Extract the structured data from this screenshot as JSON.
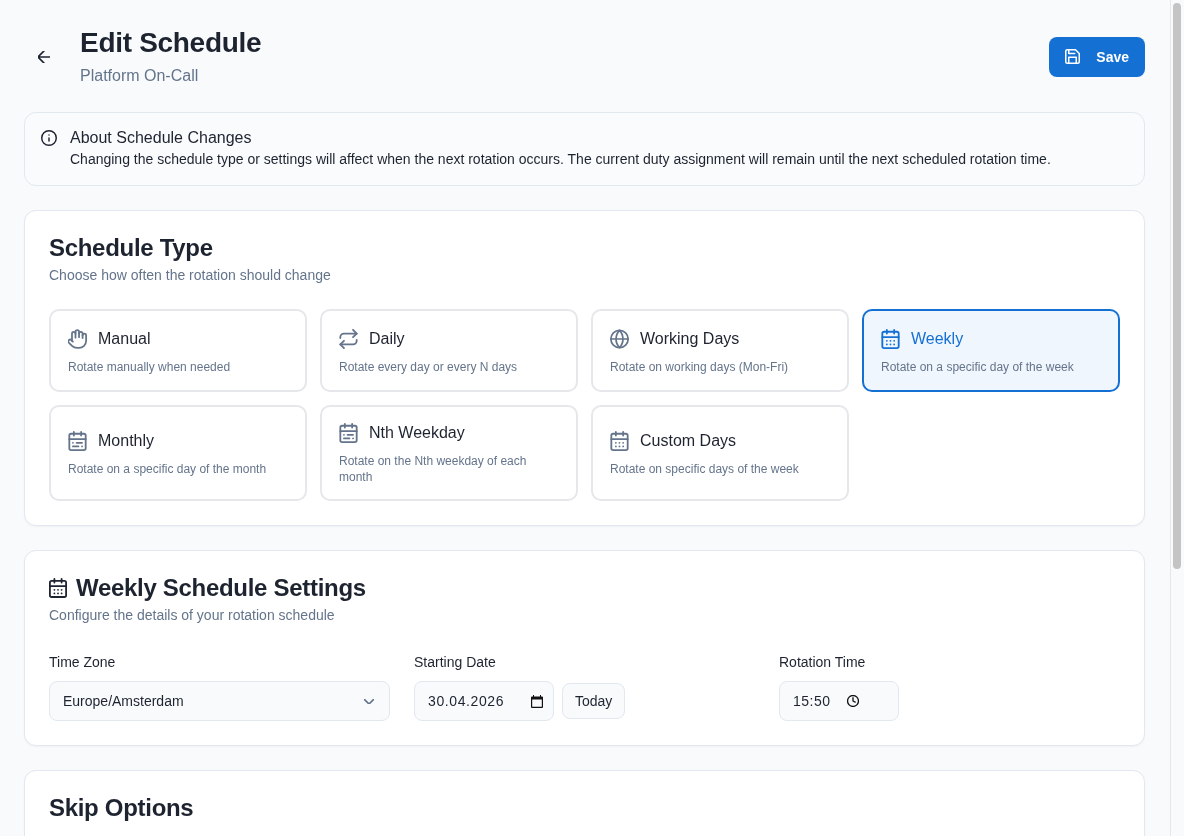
{
  "header": {
    "title": "Edit Schedule",
    "subtitle": "Platform On-Call",
    "save_button": "Save"
  },
  "info": {
    "title": "About Schedule Changes",
    "text": "Changing the schedule type or settings will affect when the next rotation occurs. The current duty assignment will remain until the next scheduled rotation time."
  },
  "schedule_type": {
    "title": "Schedule Type",
    "subtitle": "Choose how often the rotation should change",
    "options": [
      {
        "label": "Manual",
        "description": "Rotate manually when needed",
        "selected": false
      },
      {
        "label": "Daily",
        "description": "Rotate every day or every N days",
        "selected": false
      },
      {
        "label": "Working Days",
        "description": "Rotate on working days (Mon-Fri)",
        "selected": false
      },
      {
        "label": "Weekly",
        "description": "Rotate on a specific day of the week",
        "selected": true
      },
      {
        "label": "Monthly",
        "description": "Rotate on a specific day of the month",
        "selected": false
      },
      {
        "label": "Nth Weekday",
        "description": "Rotate on the Nth weekday of each month",
        "selected": false
      },
      {
        "label": "Custom Days",
        "description": "Rotate on specific days of the week",
        "selected": false
      }
    ]
  },
  "settings": {
    "title": "Weekly Schedule Settings",
    "subtitle": "Configure the details of your rotation schedule",
    "time_zone": {
      "label": "Time Zone",
      "value": "Europe/Amsterdam"
    },
    "starting_date": {
      "label": "Starting Date",
      "value": "30.04.2026",
      "today_button": "Today"
    },
    "rotation_time": {
      "label": "Rotation Time",
      "value": "15:50"
    }
  },
  "skip_options": {
    "title": "Skip Options"
  }
}
